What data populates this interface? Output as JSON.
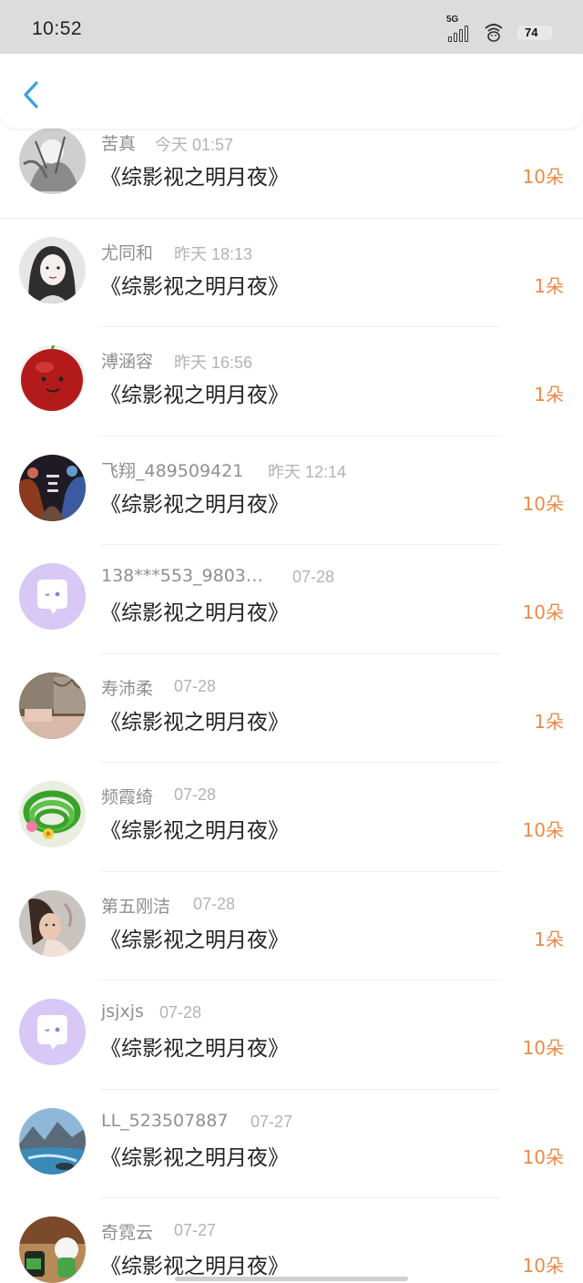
{
  "status_bar": {
    "time": "10:52",
    "network": "5G",
    "battery": "74"
  },
  "nav": {
    "back_icon": "chevron-left-icon",
    "accent": "#3a9ee6"
  },
  "colors": {
    "amount": "#ec8a4a",
    "name": "#8f8f8f",
    "time": "#b3b3b3"
  },
  "list": [
    {
      "name": "苦真",
      "time": "今天 01:57",
      "title": "《综影视之明月夜》",
      "amount": "10朵",
      "avatar": "sketch-figure"
    },
    {
      "name": "尤同和",
      "time": "昨天 18:13",
      "title": "《综影视之明月夜》",
      "amount": "1朵",
      "avatar": "girl-portrait"
    },
    {
      "name": "溥涵容",
      "time": "昨天 16:56",
      "title": "《综影视之明月夜》",
      "amount": "1朵",
      "avatar": "red-ball"
    },
    {
      "name": "飞翔_489509421",
      "time": "昨天 12:14",
      "title": "《综影视之明月夜》",
      "amount": "10朵",
      "avatar": "poster-art"
    },
    {
      "name": "138***553_9803…",
      "time": "07-28",
      "title": "《综影视之明月夜》",
      "amount": "10朵",
      "avatar": "default-chat-bubble"
    },
    {
      "name": "寿沛柔",
      "time": "07-28",
      "title": "《综影视之明月夜》",
      "amount": "1朵",
      "avatar": "room-photo"
    },
    {
      "name": "频霞绮",
      "time": "07-28",
      "title": "《综影视之明月夜》",
      "amount": "10朵",
      "avatar": "green-hose-flower"
    },
    {
      "name": "第五刚洁",
      "time": "07-28",
      "title": "《综影视之明月夜》",
      "amount": "1朵",
      "avatar": "woman-photo"
    },
    {
      "name": "jsjxjs",
      "time": "07-28",
      "title": "《综影视之明月夜》",
      "amount": "10朵",
      "avatar": "default-chat-bubble"
    },
    {
      "name": "LL_523507887",
      "time": "07-27",
      "title": "《综影视之明月夜》",
      "amount": "10朵",
      "avatar": "landscape-waterfall"
    },
    {
      "name": "奇霓云",
      "time": "07-27",
      "title": "《综影视之明月夜》",
      "amount": "10朵",
      "avatar": "toy-figures"
    }
  ]
}
